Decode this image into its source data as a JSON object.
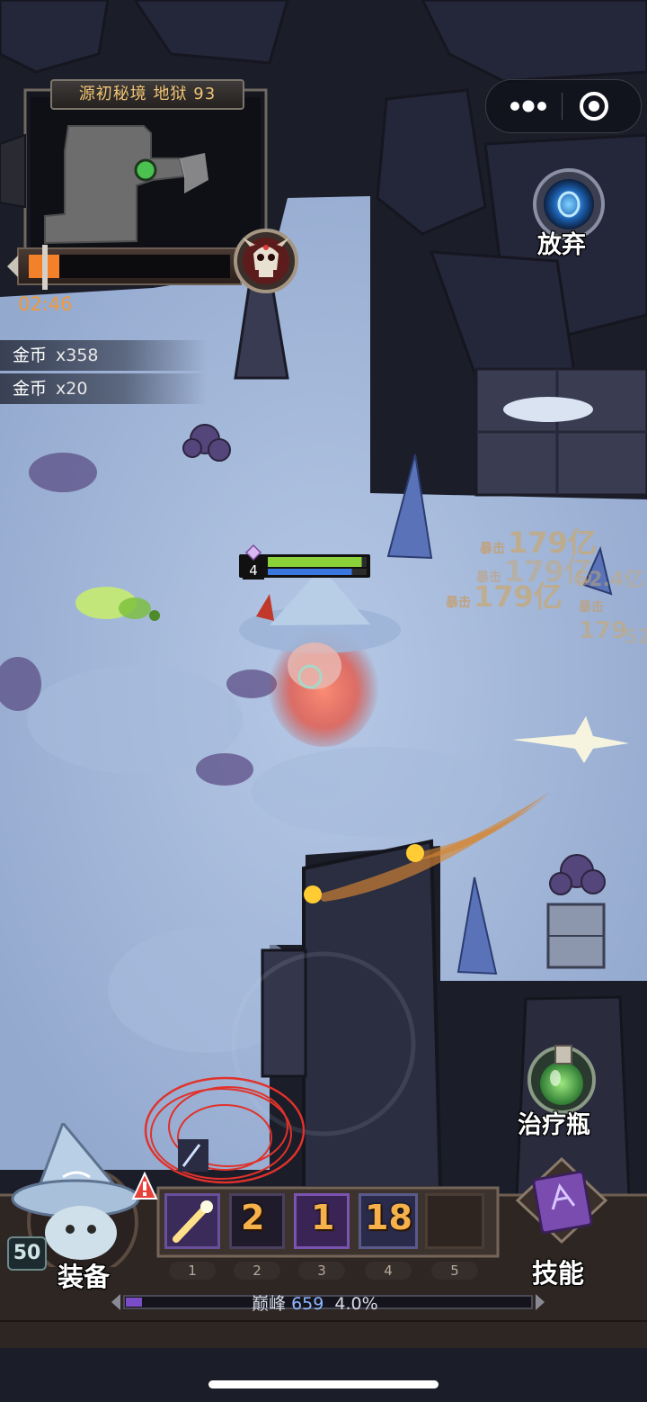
{
  "dungeon": {
    "title": "源初秘境 地狱 93",
    "timer": "02:46"
  },
  "loot": [
    {
      "name": "金币",
      "count": "x358"
    },
    {
      "name": "金币",
      "count": "x20"
    }
  ],
  "buttons": {
    "abandon": "放弃",
    "potion": "治疗瓶",
    "equip": "装备",
    "skills": "技能"
  },
  "player": {
    "level": "50",
    "hud_level": "4",
    "hp_fraction": 0.95,
    "mp_fraction": 0.85
  },
  "skill_slots": [
    {
      "hotkey": "1",
      "count": ""
    },
    {
      "hotkey": "2",
      "count": "2"
    },
    {
      "hotkey": "3",
      "count": "1"
    },
    {
      "hotkey": "4",
      "count": "18"
    },
    {
      "hotkey": "5",
      "count": ""
    }
  ],
  "progress": {
    "label": "巅峰",
    "level": "659",
    "percent": "4.0%",
    "fraction": 0.04
  },
  "damage_numbers": [
    {
      "tag": "暴击",
      "value": "179亿"
    },
    {
      "tag": "暴击",
      "value": "179亿"
    },
    {
      "tag": "暴击",
      "value": "179亿"
    },
    {
      "tag": "",
      "value": "52.4亿"
    },
    {
      "tag": "暴击",
      "value": "179"
    },
    {
      "tag": "",
      "value": "52"
    }
  ],
  "icons": {
    "capsule_more": "more-dots-icon",
    "capsule_close": "target-close-icon",
    "portal": "portal-icon",
    "potion": "potion-icon",
    "skill_book": "spellbook-icon",
    "boss": "skull-icon",
    "alert": "exclamation-icon"
  }
}
